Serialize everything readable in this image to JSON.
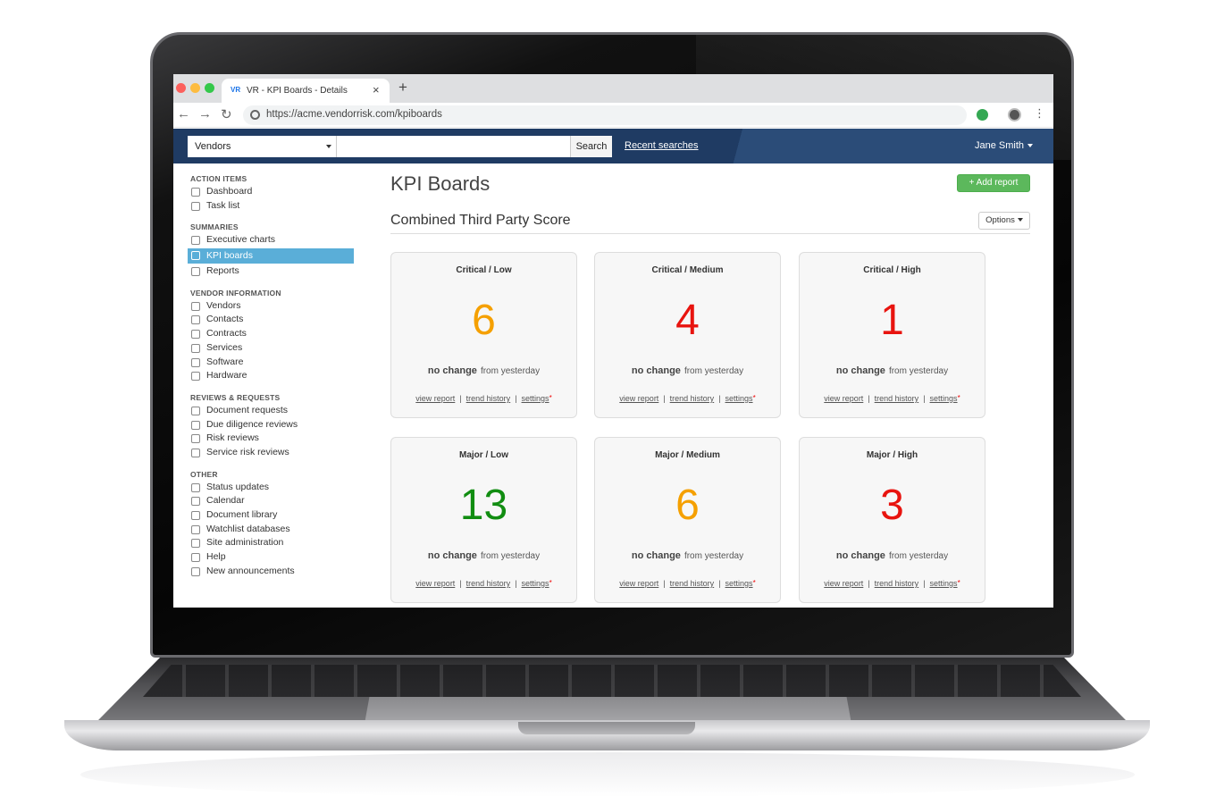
{
  "browser": {
    "tab_favicon": "VR",
    "tab_title": "VR - KPI Boards - Details",
    "tab_close": "×",
    "new_tab": "+",
    "url": "https://acme.vendorrisk.com/kpiboards",
    "nav": {
      "back": "←",
      "forward": "→",
      "reload": "↻",
      "menu": "⋮"
    }
  },
  "header": {
    "scope_selected": "Vendors",
    "search_placeholder": "",
    "search_button": "Search",
    "recent_searches": "Recent searches",
    "user_name": "Jane Smith"
  },
  "sidebar": {
    "sections": [
      {
        "heading": "ACTION ITEMS",
        "items": [
          {
            "label": "Dashboard",
            "icon": "home-icon"
          },
          {
            "label": "Task list",
            "icon": "list-icon"
          }
        ]
      },
      {
        "heading": "SUMMARIES",
        "items": [
          {
            "label": "Executive charts",
            "icon": "pie-chart-icon"
          },
          {
            "label": "KPI boards",
            "icon": "grid-icon",
            "active": true
          },
          {
            "label": "Reports",
            "icon": "document-icon"
          }
        ]
      },
      {
        "heading": "VENDOR INFORMATION",
        "items": [
          {
            "label": "Vendors",
            "icon": "users-icon"
          },
          {
            "label": "Contacts",
            "icon": "contact-card-icon"
          },
          {
            "label": "Contracts",
            "icon": "contract-icon"
          },
          {
            "label": "Services",
            "icon": "briefcase-icon"
          },
          {
            "label": "Software",
            "icon": "software-icon"
          },
          {
            "label": "Hardware",
            "icon": "monitor-icon"
          }
        ]
      },
      {
        "heading": "REVIEWS & REQUESTS",
        "items": [
          {
            "label": "Document requests",
            "icon": "document-request-icon"
          },
          {
            "label": "Due diligence reviews",
            "icon": "checklist-icon"
          },
          {
            "label": "Risk reviews",
            "icon": "scale-icon"
          },
          {
            "label": "Service risk reviews",
            "icon": "scale-icon"
          }
        ]
      },
      {
        "heading": "OTHER",
        "items": [
          {
            "label": "Status updates",
            "icon": "bell-icon"
          },
          {
            "label": "Calendar",
            "icon": "calendar-icon"
          },
          {
            "label": "Document library",
            "icon": "library-icon"
          },
          {
            "label": "Watchlist databases",
            "icon": "search-icon"
          },
          {
            "label": "Site administration",
            "icon": "gear-icon"
          },
          {
            "label": "Help",
            "icon": "help-icon"
          },
          {
            "label": "New announcements",
            "icon": "megaphone-icon"
          }
        ]
      }
    ]
  },
  "main": {
    "title": "KPI Boards",
    "add_report": "+ Add report",
    "section_title": "Combined Third Party Score",
    "options": "Options",
    "cards": [
      {
        "title": "Critical / Low",
        "value": "6",
        "color": "#f5a000",
        "change": "no change",
        "change_suffix": "from yesterday"
      },
      {
        "title": "Critical / Medium",
        "value": "4",
        "color": "#e8140f",
        "change": "no change",
        "change_suffix": "from yesterday"
      },
      {
        "title": "Critical / High",
        "value": "1",
        "color": "#e8140f",
        "change": "no change",
        "change_suffix": "from yesterday"
      },
      {
        "title": "Major / Low",
        "value": "13",
        "color": "#118d11",
        "change": "no change",
        "change_suffix": "from yesterday"
      },
      {
        "title": "Major / Medium",
        "value": "6",
        "color": "#f5a000",
        "change": "no change",
        "change_suffix": "from yesterday"
      },
      {
        "title": "Major / High",
        "value": "3",
        "color": "#e8140f",
        "change": "no change",
        "change_suffix": "from yesterday"
      }
    ],
    "card_links": {
      "view_report": "view report",
      "trend_history": "trend history",
      "settings": "settings",
      "separator": "|",
      "required_mark": "*"
    }
  }
}
